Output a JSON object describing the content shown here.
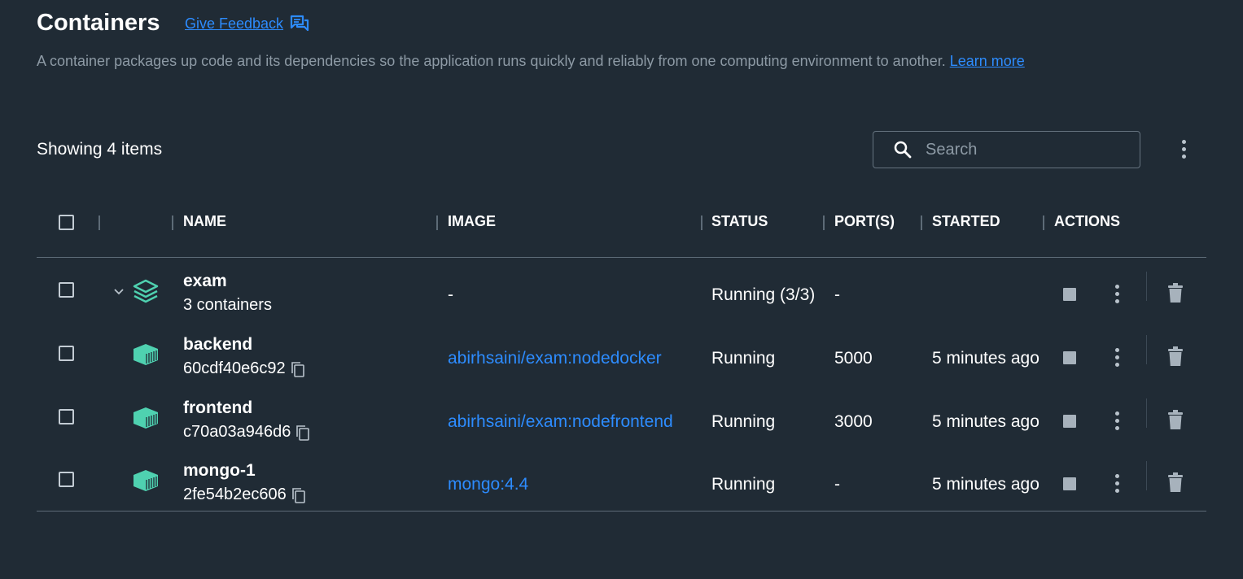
{
  "page": {
    "title": "Containers",
    "feedback_label": "Give Feedback",
    "description": "A container packages up code and its dependencies so the application runs quickly and reliably from one computing environment to another.",
    "learn_more": "Learn more",
    "showing": "Showing 4 items",
    "search_placeholder": "Search"
  },
  "columns": {
    "name": "NAME",
    "image": "IMAGE",
    "status": "STATUS",
    "ports": "PORT(S)",
    "started": "STARTED",
    "actions": "ACTIONS"
  },
  "rows": [
    {
      "name": "exam",
      "sub": "3 containers",
      "image": "-",
      "status": "Running (3/3)",
      "ports": "-",
      "started": "",
      "icon": "stack-icon"
    },
    {
      "name": "backend",
      "sub": "60cdf40e6c92",
      "image": "abirhsaini/exam:nodedocker",
      "status": "Running",
      "ports": "5000",
      "started": "5 minutes ago",
      "icon": "container-icon"
    },
    {
      "name": "frontend",
      "sub": "c70a03a946d6",
      "image": "abirhsaini/exam:nodefrontend",
      "status": "Running",
      "ports": "3000",
      "started": "5 minutes ago",
      "icon": "container-icon"
    },
    {
      "name": "mongo-1",
      "sub": "2fe54b2ec606",
      "image": "mongo:4.4",
      "status": "Running",
      "ports": "-",
      "started": "5 minutes ago",
      "icon": "container-icon"
    }
  ],
  "colors": {
    "background": "#202b35",
    "link": "#2d8cff",
    "accent_green": "#4fd1b0",
    "muted_text": "#8d9aa5"
  }
}
